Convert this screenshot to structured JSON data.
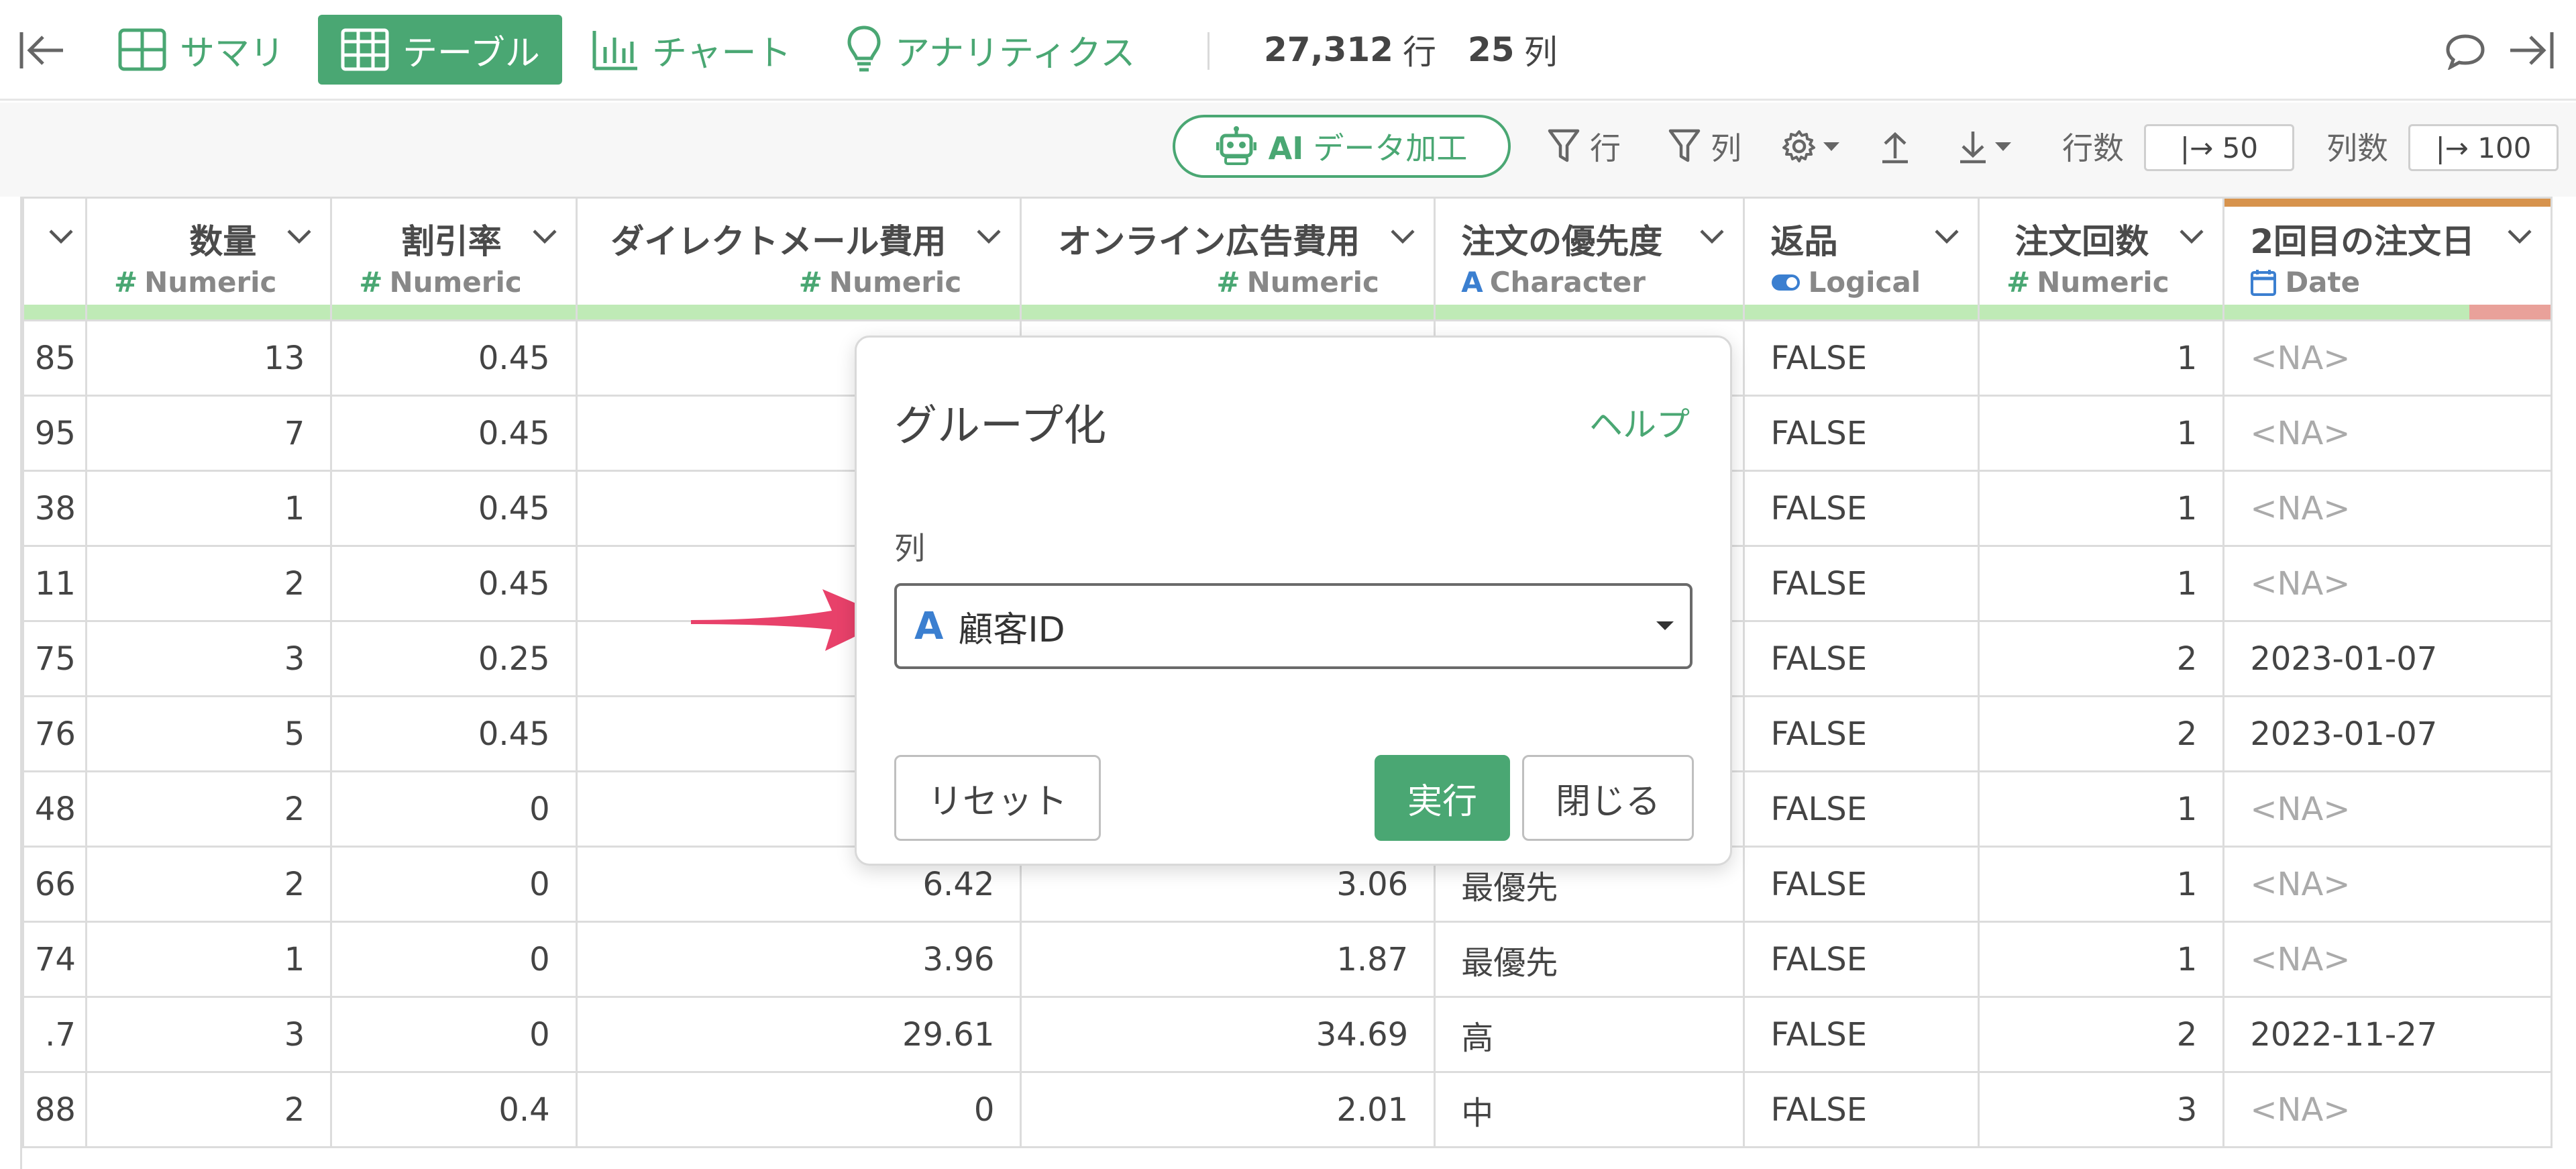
{
  "topbar": {
    "collapse_left_icon": "collapse-left-icon",
    "tabs": [
      {
        "label": "サマリ",
        "icon": "summary-grid-icon"
      },
      {
        "label": "テーブル",
        "icon": "table-icon",
        "active": true
      },
      {
        "label": "チャート",
        "icon": "bar-chart-icon"
      },
      {
        "label": "アナリティクス",
        "icon": "lightbulb-icon"
      }
    ],
    "rows_count": "27,312",
    "rows_unit": "行",
    "cols_count": "25",
    "cols_unit": "列",
    "comment_icon": "comment-icon",
    "collapse_right_icon": "collapse-right-icon"
  },
  "toolbar": {
    "ai_button": {
      "ai": "AI",
      "label": "データ加工",
      "icon": "robot-icon"
    },
    "filter_rows_label": "行",
    "filter_cols_label": "列",
    "settings_icon": "gear-icon",
    "export_icon": "upload-icon",
    "import_icon": "download-icon",
    "rows_label": "行数",
    "rows_value": "|→ 50",
    "cols_label": "列数",
    "cols_value": "|→ 100"
  },
  "table": {
    "columns": [
      {
        "name": "",
        "type": "",
        "type_icon": ""
      },
      {
        "name": "数量",
        "type": "Numeric",
        "type_icon": "#"
      },
      {
        "name": "割引率",
        "type": "Numeric",
        "type_icon": "#"
      },
      {
        "name": "ダイレクトメール費用",
        "type": "Numeric",
        "type_icon": "#"
      },
      {
        "name": "オンライン広告費用",
        "type": "Numeric",
        "type_icon": "#"
      },
      {
        "name": "注文の優先度",
        "type": "Character",
        "type_icon": "A"
      },
      {
        "name": "返品",
        "type": "Logical",
        "type_icon": "toggle"
      },
      {
        "name": "注文回数",
        "type": "Numeric",
        "type_icon": "#"
      },
      {
        "name": "2回目の注文日",
        "type": "Date",
        "type_icon": "calendar"
      }
    ],
    "na_fraction_last_column": 0.25,
    "rows": [
      [
        "85",
        "13",
        "0.45",
        "",
        "",
        "",
        "FALSE",
        "1",
        "<NA>"
      ],
      [
        "95",
        "7",
        "0.45",
        "",
        "",
        "",
        "FALSE",
        "1",
        "<NA>"
      ],
      [
        "38",
        "1",
        "0.45",
        "",
        "",
        "",
        "FALSE",
        "1",
        "<NA>"
      ],
      [
        "11",
        "2",
        "0.45",
        "",
        "",
        "",
        "FALSE",
        "1",
        "<NA>"
      ],
      [
        "75",
        "3",
        "0.25",
        "",
        "",
        "",
        "FALSE",
        "2",
        "2023-01-07"
      ],
      [
        "76",
        "5",
        "0.45",
        "",
        "",
        "",
        "FALSE",
        "2",
        "2023-01-07"
      ],
      [
        "48",
        "2",
        "0",
        "",
        "",
        "",
        "FALSE",
        "1",
        "<NA>"
      ],
      [
        "66",
        "2",
        "0",
        "6.42",
        "3.06",
        "最優先",
        "FALSE",
        "1",
        "<NA>"
      ],
      [
        "74",
        "1",
        "0",
        "3.96",
        "1.87",
        "最優先",
        "FALSE",
        "1",
        "<NA>"
      ],
      [
        ".7",
        "3",
        "0",
        "29.61",
        "34.69",
        "高",
        "FALSE",
        "2",
        "2022-11-27"
      ],
      [
        "88",
        "2",
        "0.4",
        "0",
        "2.01",
        "中",
        "FALSE",
        "3",
        "<NA>"
      ]
    ]
  },
  "dialog": {
    "title": "グループ化",
    "help": "ヘルプ",
    "column_label": "列",
    "selected_column": "顧客ID",
    "selected_type_icon": "A",
    "reset": "リセット",
    "run": "実行",
    "close": "閉じる"
  },
  "colors": {
    "brand_green": "#4aa773",
    "quality_ok": "#bfeab6",
    "quality_na": "#e9a19a",
    "highlight_strip": "#d7934d",
    "arrow": "#e8416a"
  }
}
